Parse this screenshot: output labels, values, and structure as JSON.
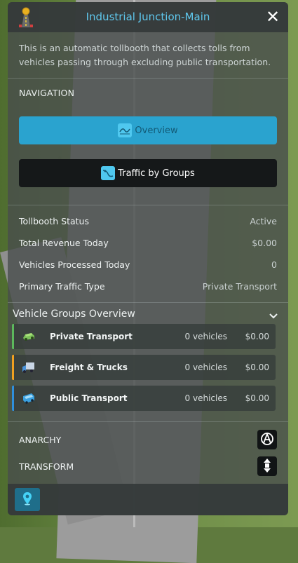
{
  "header": {
    "title": "Industrial Junction-Main",
    "close_label": "✕"
  },
  "description": "This is an automatic tollbooth that collects tolls from vehicles passing through excluding public transportation.",
  "navigation": {
    "label": "NAVIGATION",
    "overview_label": "Overview",
    "traffic_label": "Traffic by Groups"
  },
  "stats": [
    {
      "label": "Tollbooth Status",
      "value": "Active"
    },
    {
      "label": "Total Revenue Today",
      "value": "$0.00"
    },
    {
      "label": "Vehicles Processed Today",
      "value": "0"
    },
    {
      "label": "Primary Traffic Type",
      "value": "Private Transport"
    }
  ],
  "groups": {
    "title": "Vehicle Groups Overview",
    "items": [
      {
        "name": "Private Transport",
        "count": "0 vehicles",
        "revenue": "$0.00",
        "color": "#5cb85c",
        "icon": "car-icon"
      },
      {
        "name": "Freight & Trucks",
        "count": "0 vehicles",
        "revenue": "$0.00",
        "color": "#f0a020",
        "icon": "truck-icon"
      },
      {
        "name": "Public Transport",
        "count": "0 vehicles",
        "revenue": "$0.00",
        "color": "#2f8fdc",
        "icon": "bus-icon"
      }
    ]
  },
  "tools": {
    "anarchy_label": "ANARCHY",
    "transform_label": "TRANSFORM"
  },
  "colors": {
    "accent": "#2aa3cf",
    "title": "#5fc8ee"
  }
}
